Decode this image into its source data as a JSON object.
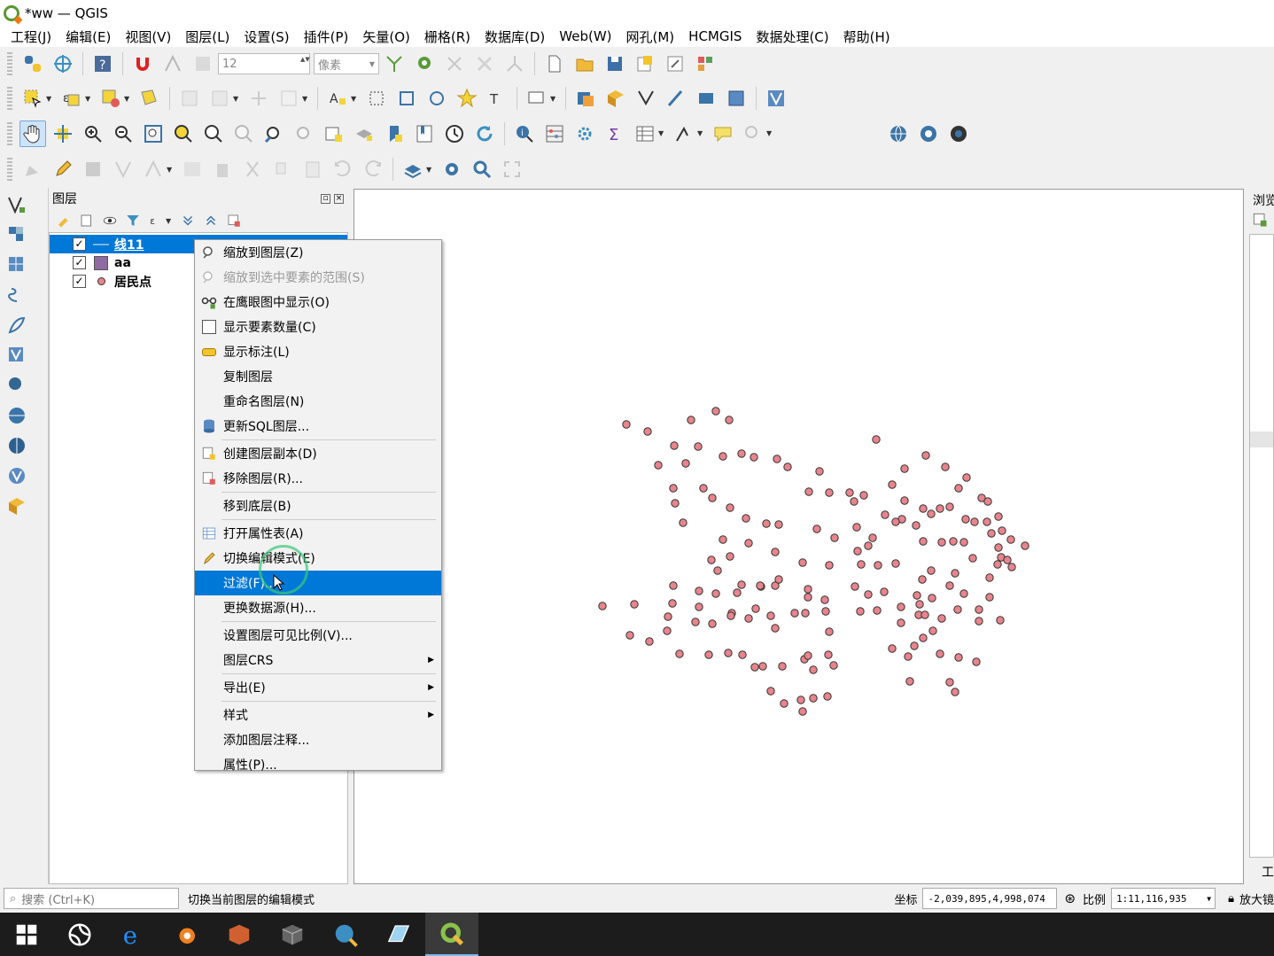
{
  "window": {
    "title": "*ww — QGIS"
  },
  "menubar": [
    "工程(J)",
    "编辑(E)",
    "视图(V)",
    "图层(L)",
    "设置(S)",
    "插件(P)",
    "矢量(O)",
    "栅格(R)",
    "数据库(D)",
    "Web(W)",
    "网孔(M)",
    "HCMGIS",
    "数据处理(C)",
    "帮助(H)"
  ],
  "toolbar": {
    "font_size": "12",
    "unit": "像素"
  },
  "layers_panel": {
    "title": "图层",
    "layers": [
      {
        "name": "线11",
        "checked": "✓",
        "selected": true
      },
      {
        "name": "aa",
        "checked": "✓"
      },
      {
        "name": "居民点",
        "checked": "✓"
      }
    ]
  },
  "context_menu": {
    "items": [
      {
        "label": "缩放到图层(Z)"
      },
      {
        "label": "缩放到选中要素的范围(S)",
        "disabled": true
      },
      {
        "label": "在鹰眼图中显示(O)"
      },
      {
        "label": "显示要素数量(C)"
      },
      {
        "label": "显示标注(L)"
      },
      {
        "label": "复制图层"
      },
      {
        "label": "重命名图层(N)"
      },
      {
        "label": "更新SQL图层..."
      },
      {
        "label": "创建图层副本(D)"
      },
      {
        "label": "移除图层(R)..."
      },
      {
        "label": "移到底层(B)"
      },
      {
        "label": "打开属性表(A)"
      },
      {
        "label": "切换编辑模式(E)"
      },
      {
        "label": "过滤(F)...",
        "highlighted": true
      },
      {
        "label": "更换数据源(H)..."
      },
      {
        "label": "设置图层可见比例(V)..."
      },
      {
        "label": "图层CRS"
      },
      {
        "label": "导出(E)"
      },
      {
        "label": "样式"
      },
      {
        "label": "添加图层注释..."
      },
      {
        "label": "属性(P)..."
      }
    ]
  },
  "right_panel": {
    "title": "浏览",
    "bottom_tab": "工"
  },
  "statusbar": {
    "search_placeholder": "搜索 (Ctrl+K)",
    "message": "切换当前图层的编辑模式",
    "coord_label": "坐标",
    "coord_value": "-2,039,895,4,998,074",
    "scale_label": "比例",
    "scale_value": "1:11,116,935",
    "magnifier_label": "放大镜"
  },
  "colors": {
    "point_fill": "#e8848c",
    "point_stroke": "#333333",
    "selection": "#0078d7",
    "polygon_symbol": "#8e6ba0"
  }
}
